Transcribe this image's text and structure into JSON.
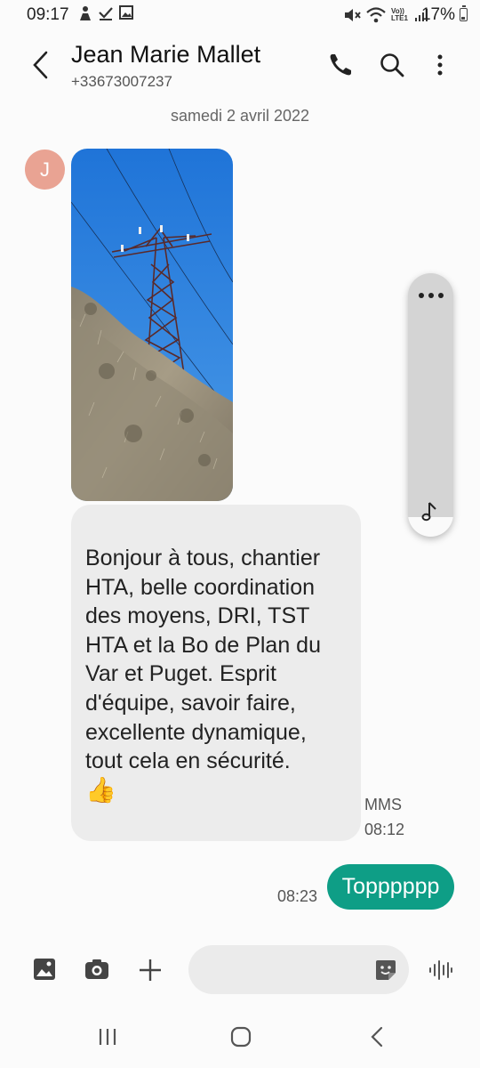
{
  "status_bar": {
    "time": "09:17",
    "battery": "17%",
    "left_icons": [
      "person-icon",
      "check-download-icon",
      "image-icon"
    ],
    "right_icons": [
      "mute-icon",
      "wifi-icon",
      "volte-icon",
      "signal-icon",
      "battery-icon"
    ],
    "volte_text": "Vo)) LTE1"
  },
  "header": {
    "contact_name": "Jean Marie Mallet",
    "contact_number": "+33673007237",
    "icons": [
      "back-icon",
      "phone-icon",
      "search-icon",
      "more-icon"
    ]
  },
  "conversation": {
    "date_separator": "samedi 2 avril 2022",
    "avatar_initial": "J",
    "incoming_text": "Bonjour à tous, chantier HTA, belle coordination des moyens, DRI, TST HTA et la Bo de Plan du Var et Puget. Esprit d'équipe, savoir faire, excellente dynamique, tout cela en sécurité.",
    "incoming_emoji": "👍",
    "incoming_type": "MMS",
    "incoming_time": "08:12",
    "outgoing_text": "Topppppp",
    "outgoing_time": "08:23"
  },
  "side_panel": {
    "icons": [
      "more-horizontal-icon",
      "music-note-icon"
    ]
  },
  "composer": {
    "icons": [
      "gallery-icon",
      "camera-icon",
      "add-icon",
      "sticker-icon",
      "voice-icon"
    ],
    "placeholder": ""
  },
  "nav_bar": {
    "icons": [
      "recents-icon",
      "home-icon",
      "back-nav-icon"
    ]
  },
  "colors": {
    "accent_outgoing": "#0e9e86",
    "avatar": "#e9a393",
    "incoming_bubble": "#ececec"
  }
}
